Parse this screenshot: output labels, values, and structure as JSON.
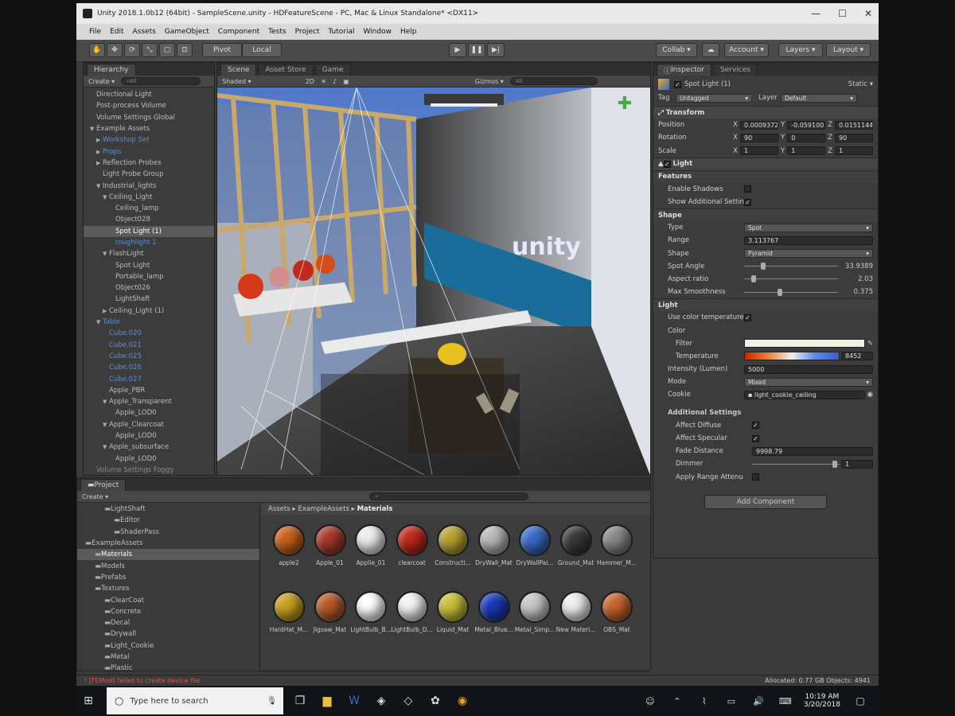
{
  "window": {
    "title": "Unity 2018.1.0b12 (64bit) - SampleScene.unity - HDFeatureScene - PC, Mac & Linux Standalone* <DX11>",
    "minimize": "—",
    "maximize": "☐",
    "close": "✕"
  },
  "menu": [
    "File",
    "Edit",
    "Assets",
    "GameObject",
    "Component",
    "Tests",
    "Project",
    "Tutorial",
    "Window",
    "Help"
  ],
  "toolbar": {
    "pivot": "Pivot",
    "local": "Local",
    "collab": "Collab ▾",
    "account": "Account ▾",
    "layers": "Layers ▾",
    "layout": "Layout ▾"
  },
  "hierarchy": {
    "tab": "Hierarchy",
    "create": "Create ▾",
    "search": "All",
    "rows": [
      {
        "label": "Directional Light",
        "indent": 1,
        "arrow": "",
        "style": ""
      },
      {
        "label": "Post-process Volume",
        "indent": 1,
        "arrow": "",
        "style": ""
      },
      {
        "label": "Volume Settings Global",
        "indent": 1,
        "arrow": "",
        "style": ""
      },
      {
        "label": "Example Assets",
        "indent": 1,
        "arrow": "▼",
        "style": ""
      },
      {
        "label": "Workshop Set",
        "indent": 2,
        "arrow": "▶",
        "style": "blue"
      },
      {
        "label": "Props",
        "indent": 2,
        "arrow": "▶",
        "style": "blue"
      },
      {
        "label": "Reflection Probes",
        "indent": 2,
        "arrow": "▶",
        "style": ""
      },
      {
        "label": "Light Probe Group",
        "indent": 2,
        "arrow": "",
        "style": ""
      },
      {
        "label": "Industrial_lights",
        "indent": 2,
        "arrow": "▼",
        "style": ""
      },
      {
        "label": "Ceiling_Light",
        "indent": 3,
        "arrow": "▼",
        "style": ""
      },
      {
        "label": "Ceiling_lamp",
        "indent": 4,
        "arrow": "",
        "style": ""
      },
      {
        "label": "Object028",
        "indent": 4,
        "arrow": "",
        "style": ""
      },
      {
        "label": "Spot Light (1)",
        "indent": 4,
        "arrow": "",
        "style": "sel"
      },
      {
        "label": "roughlight 1",
        "indent": 4,
        "arrow": "",
        "style": "blue"
      },
      {
        "label": "FlashLight",
        "indent": 3,
        "arrow": "▼",
        "style": ""
      },
      {
        "label": "Spot Light",
        "indent": 4,
        "arrow": "",
        "style": ""
      },
      {
        "label": "Portable_lamp",
        "indent": 4,
        "arrow": "",
        "style": ""
      },
      {
        "label": "Object026",
        "indent": 4,
        "arrow": "",
        "style": ""
      },
      {
        "label": "LightShaft",
        "indent": 4,
        "arrow": "",
        "style": ""
      },
      {
        "label": "Ceiling_Light (1)",
        "indent": 3,
        "arrow": "▶",
        "style": ""
      },
      {
        "label": "Table",
        "indent": 2,
        "arrow": "▼",
        "style": "blue"
      },
      {
        "label": "Cube.020",
        "indent": 3,
        "arrow": "",
        "style": "blue"
      },
      {
        "label": "Cube.021",
        "indent": 3,
        "arrow": "",
        "style": "blue"
      },
      {
        "label": "Cube.025",
        "indent": 3,
        "arrow": "",
        "style": "blue"
      },
      {
        "label": "Cube.026",
        "indent": 3,
        "arrow": "",
        "style": "blue"
      },
      {
        "label": "Cube.027",
        "indent": 3,
        "arrow": "",
        "style": "blue"
      },
      {
        "label": "Apple_PBR",
        "indent": 3,
        "arrow": "",
        "style": ""
      },
      {
        "label": "Apple_Transparent",
        "indent": 3,
        "arrow": "▼",
        "style": ""
      },
      {
        "label": "Apple_LOD0",
        "indent": 4,
        "arrow": "",
        "style": ""
      },
      {
        "label": "Apple_Clearcoat",
        "indent": 3,
        "arrow": "▼",
        "style": ""
      },
      {
        "label": "Apple_LOD0",
        "indent": 4,
        "arrow": "",
        "style": ""
      },
      {
        "label": "Apple_subsurface",
        "indent": 3,
        "arrow": "▼",
        "style": ""
      },
      {
        "label": "Apple_LOD0",
        "indent": 4,
        "arrow": "",
        "style": ""
      },
      {
        "label": "Volume Settings Foggy",
        "indent": 1,
        "arrow": "",
        "style": "faded"
      }
    ]
  },
  "scene": {
    "tabs": [
      "Scene",
      "Asset Store",
      "Game"
    ],
    "shaded": "Shaded ▾",
    "mode2d": "2D",
    "gizmos": "Gizmos ▾",
    "search": "All",
    "persp": "≡ Persp",
    "logo_text": "unity"
  },
  "inspector": {
    "tabs": [
      "Inspector",
      "Services"
    ],
    "object_name": "Spot Light (1)",
    "static": "Static ▾",
    "tag_label": "Tag",
    "tag_value": "Untagged",
    "layer_label": "Layer",
    "layer_value": "Default",
    "transform": {
      "title": "Transform",
      "rows": [
        {
          "label": "Position",
          "x": "0.0009372",
          "y": "-0.0591002",
          "z": "0.0151144"
        },
        {
          "label": "Rotation",
          "x": "90",
          "y": "0",
          "z": "90"
        },
        {
          "label": "Scale",
          "x": "1",
          "y": "1",
          "z": "1"
        }
      ]
    },
    "light_component": "Light",
    "features": {
      "title": "Features",
      "enable_shadows": "Enable Shadows",
      "show_additional": "Show Additional Settin"
    },
    "shape": {
      "title": "Shape",
      "type_label": "Type",
      "type_value": "Spot",
      "range_label": "Range",
      "range_value": "3.113767",
      "shape_label": "Shape",
      "shape_value": "Pyramid",
      "spot_angle_label": "Spot Angle",
      "spot_angle_value": "33.9389",
      "aspect_label": "Aspect ratio",
      "aspect_value": "2.03",
      "smooth_label": "Max Smoothness",
      "smooth_value": "0.375"
    },
    "light": {
      "title": "Light",
      "use_color_temp": "Use color temperature",
      "color": "Color",
      "filter": "Filter",
      "temperature_label": "Temperature",
      "temperature_value": "8452",
      "intensity_label": "Intensity (Lumen)",
      "intensity_value": "5000",
      "mode_label": "Mode",
      "mode_value": "Mixed",
      "cookie_label": "Cookie",
      "cookie_value": "light_cookie_ceiling"
    },
    "additional": {
      "title": "Additional Settings",
      "affect_diffuse": "Affect Diffuse",
      "affect_specular": "Affect Specular",
      "fade_label": "Fade Distance",
      "fade_value": "9998.79",
      "dimmer_label": "Dimmer",
      "dimmer_value": "1",
      "apply_range": "Apply Range Attenu"
    },
    "add_component": "Add Component"
  },
  "project": {
    "tab": "Project",
    "create": "Create ▾",
    "breadcrumb": [
      "Assets",
      "ExampleAssets",
      "Materials"
    ],
    "tree": [
      {
        "label": "LightShaft",
        "indent": 2
      },
      {
        "label": "Editor",
        "indent": 3
      },
      {
        "label": "ShaderPass",
        "indent": 3
      },
      {
        "label": "ExampleAssets",
        "indent": 0
      },
      {
        "label": "Materials",
        "indent": 1
      },
      {
        "label": "Models",
        "indent": 1
      },
      {
        "label": "Prefabs",
        "indent": 1
      },
      {
        "label": "Textures",
        "indent": 1
      },
      {
        "label": "ClearCoat",
        "indent": 2
      },
      {
        "label": "Concrete",
        "indent": 2
      },
      {
        "label": "Decal",
        "indent": 2
      },
      {
        "label": "Drywall",
        "indent": 2
      },
      {
        "label": "Light_Cookie",
        "indent": 2
      },
      {
        "label": "Metal",
        "indent": 2
      },
      {
        "label": "Plastic",
        "indent": 2
      }
    ],
    "materials": [
      {
        "name": "apple2",
        "color": "#c8621a"
      },
      {
        "name": "Apple_01",
        "color": "#a83a2a"
      },
      {
        "name": "Applie_01",
        "color": "#eeeeee"
      },
      {
        "name": "clearcoat",
        "color": "#c0281a"
      },
      {
        "name": "Constructi...",
        "color": "#b8a232"
      },
      {
        "name": "DryWall_Mat",
        "color": "#b8b8b8"
      },
      {
        "name": "DryWallPai...",
        "color": "#3a6ac8"
      },
      {
        "name": "Ground_Mat",
        "color": "#3a3a3a"
      },
      {
        "name": "Hammer_M...",
        "color": "#888888"
      },
      {
        "name": "HardHat_M...",
        "color": "#c8a020"
      },
      {
        "name": "Jigsaw_Mat",
        "color": "#b85a2a"
      },
      {
        "name": "LightBulb_B...",
        "color": "#ffffff"
      },
      {
        "name": "LightBulb_D...",
        "color": "#f4f4f4"
      },
      {
        "name": "Liquid_Mat",
        "color": "#c8c03a"
      },
      {
        "name": "Metal_Blue...",
        "color": "#1a3ab8"
      },
      {
        "name": "Metal_Simp...",
        "color": "#c8c8c8"
      },
      {
        "name": "New Materi...",
        "color": "#f0f0f0"
      },
      {
        "name": "OBS_Mat",
        "color": "#c8642a"
      }
    ]
  },
  "status": {
    "error": "! [FEMod] failed to create device file",
    "right": "Allocated: 0.77 GB Objects: 4941"
  },
  "taskbar": {
    "search_placeholder": "Type here to search",
    "time": "10:19 AM",
    "date": "3/20/2018"
  },
  "colors": {
    "selection": "#5a5a5a",
    "blue_prefab": "#5c8fd6",
    "panel": "#3c3c3c"
  }
}
